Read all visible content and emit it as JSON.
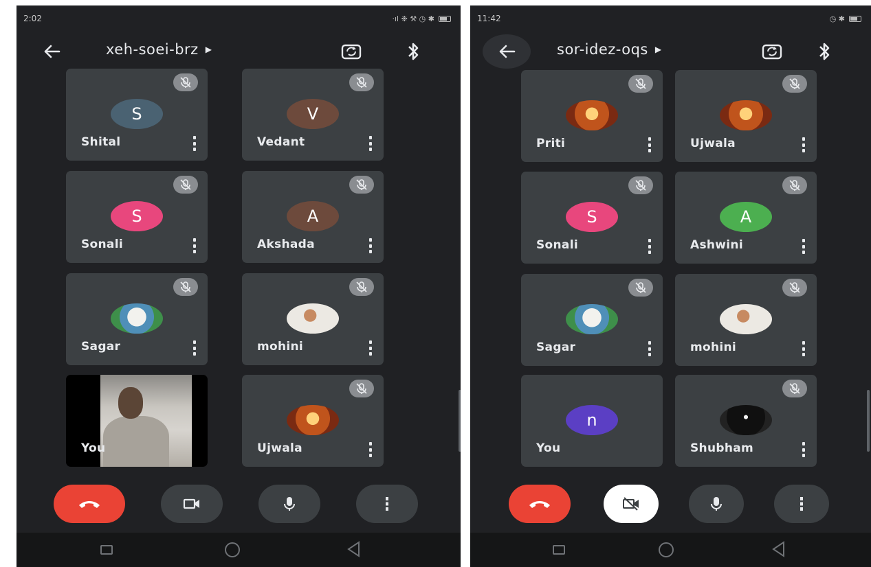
{
  "left": {
    "status": {
      "time": "2:02",
      "icons": "·ıl ❉ ⚒ ◷ ✱"
    },
    "meeting_code": "xeh-soei-brz",
    "tiles": [
      {
        "name": "Shital",
        "initial": "S",
        "avatar_color": "#4a6272",
        "muted": true
      },
      {
        "name": "Vedant",
        "initial": "V",
        "avatar_color": "#6d4a3c",
        "muted": true
      },
      {
        "name": "Sonali",
        "initial": "S",
        "avatar_color": "#e8477d",
        "muted": true
      },
      {
        "name": "Akshada",
        "initial": "A",
        "avatar_color": "#6d4a3c",
        "muted": true
      },
      {
        "name": "Sagar",
        "initial": "",
        "avatar_icon": "temple-photo",
        "muted": true
      },
      {
        "name": "mohini",
        "initial": "",
        "avatar_icon": "person-photo",
        "muted": true
      },
      {
        "name": "You",
        "initial": "",
        "avatar_icon": "camera-feed",
        "muted": false
      },
      {
        "name": "Ujwala",
        "initial": "",
        "avatar_icon": "deity-photo",
        "muted": true
      }
    ],
    "controls": [
      {
        "icon": "hang-up-icon",
        "color": "#ea4335"
      },
      {
        "icon": "camera-icon",
        "color": "#3c4043"
      },
      {
        "icon": "mic-icon",
        "color": "#3c4043"
      },
      {
        "icon": "more-options-icon",
        "color": "#3c4043"
      }
    ]
  },
  "right": {
    "status": {
      "time": "11:42",
      "icons": "◷ ✱"
    },
    "meeting_code": "sor-idez-oqs",
    "tiles": [
      {
        "name": "Priti",
        "initial": "",
        "avatar_icon": "deity-photo",
        "muted": true
      },
      {
        "name": "Ujwala",
        "initial": "",
        "avatar_icon": "deity-photo",
        "muted": true
      },
      {
        "name": "Sonali",
        "initial": "S",
        "avatar_color": "#e8477d",
        "muted": true
      },
      {
        "name": "Ashwini",
        "initial": "A",
        "avatar_color": "#4caf50",
        "muted": true
      },
      {
        "name": "Sagar",
        "initial": "",
        "avatar_icon": "temple-photo",
        "muted": true
      },
      {
        "name": "mohini",
        "initial": "",
        "avatar_icon": "person-photo",
        "muted": true
      },
      {
        "name": "You",
        "initial": "n",
        "avatar_color": "#5b3fc4",
        "muted": false
      },
      {
        "name": "Shubham",
        "initial": "",
        "avatar_icon": "silhouette-photo",
        "muted": true
      }
    ],
    "controls": [
      {
        "icon": "hang-up-icon",
        "color": "#ea4335"
      },
      {
        "icon": "camera-off-icon",
        "color": "#ffffff"
      },
      {
        "icon": "mic-icon",
        "color": "#3c4043"
      },
      {
        "icon": "more-options-icon",
        "color": "#3c4043"
      }
    ]
  }
}
